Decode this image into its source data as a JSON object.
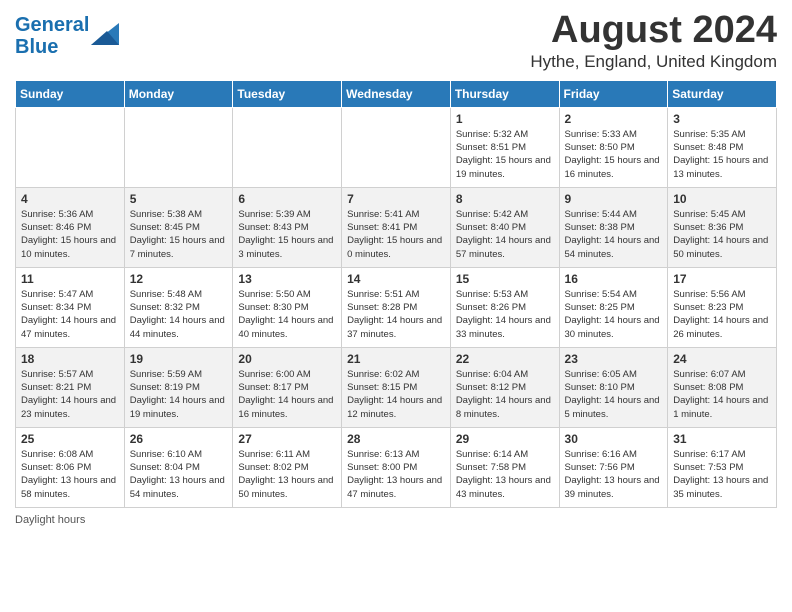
{
  "logo": {
    "line1": "General",
    "line2": "Blue"
  },
  "title": "August 2024",
  "subtitle": "Hythe, England, United Kingdom",
  "days_of_week": [
    "Sunday",
    "Monday",
    "Tuesday",
    "Wednesday",
    "Thursday",
    "Friday",
    "Saturday"
  ],
  "weeks": [
    [
      {
        "day": "",
        "info": ""
      },
      {
        "day": "",
        "info": ""
      },
      {
        "day": "",
        "info": ""
      },
      {
        "day": "",
        "info": ""
      },
      {
        "day": "1",
        "info": "Sunrise: 5:32 AM\nSunset: 8:51 PM\nDaylight: 15 hours\nand 19 minutes."
      },
      {
        "day": "2",
        "info": "Sunrise: 5:33 AM\nSunset: 8:50 PM\nDaylight: 15 hours\nand 16 minutes."
      },
      {
        "day": "3",
        "info": "Sunrise: 5:35 AM\nSunset: 8:48 PM\nDaylight: 15 hours\nand 13 minutes."
      }
    ],
    [
      {
        "day": "4",
        "info": "Sunrise: 5:36 AM\nSunset: 8:46 PM\nDaylight: 15 hours\nand 10 minutes."
      },
      {
        "day": "5",
        "info": "Sunrise: 5:38 AM\nSunset: 8:45 PM\nDaylight: 15 hours\nand 7 minutes."
      },
      {
        "day": "6",
        "info": "Sunrise: 5:39 AM\nSunset: 8:43 PM\nDaylight: 15 hours\nand 3 minutes."
      },
      {
        "day": "7",
        "info": "Sunrise: 5:41 AM\nSunset: 8:41 PM\nDaylight: 15 hours\nand 0 minutes."
      },
      {
        "day": "8",
        "info": "Sunrise: 5:42 AM\nSunset: 8:40 PM\nDaylight: 14 hours\nand 57 minutes."
      },
      {
        "day": "9",
        "info": "Sunrise: 5:44 AM\nSunset: 8:38 PM\nDaylight: 14 hours\nand 54 minutes."
      },
      {
        "day": "10",
        "info": "Sunrise: 5:45 AM\nSunset: 8:36 PM\nDaylight: 14 hours\nand 50 minutes."
      }
    ],
    [
      {
        "day": "11",
        "info": "Sunrise: 5:47 AM\nSunset: 8:34 PM\nDaylight: 14 hours\nand 47 minutes."
      },
      {
        "day": "12",
        "info": "Sunrise: 5:48 AM\nSunset: 8:32 PM\nDaylight: 14 hours\nand 44 minutes."
      },
      {
        "day": "13",
        "info": "Sunrise: 5:50 AM\nSunset: 8:30 PM\nDaylight: 14 hours\nand 40 minutes."
      },
      {
        "day": "14",
        "info": "Sunrise: 5:51 AM\nSunset: 8:28 PM\nDaylight: 14 hours\nand 37 minutes."
      },
      {
        "day": "15",
        "info": "Sunrise: 5:53 AM\nSunset: 8:26 PM\nDaylight: 14 hours\nand 33 minutes."
      },
      {
        "day": "16",
        "info": "Sunrise: 5:54 AM\nSunset: 8:25 PM\nDaylight: 14 hours\nand 30 minutes."
      },
      {
        "day": "17",
        "info": "Sunrise: 5:56 AM\nSunset: 8:23 PM\nDaylight: 14 hours\nand 26 minutes."
      }
    ],
    [
      {
        "day": "18",
        "info": "Sunrise: 5:57 AM\nSunset: 8:21 PM\nDaylight: 14 hours\nand 23 minutes."
      },
      {
        "day": "19",
        "info": "Sunrise: 5:59 AM\nSunset: 8:19 PM\nDaylight: 14 hours\nand 19 minutes."
      },
      {
        "day": "20",
        "info": "Sunrise: 6:00 AM\nSunset: 8:17 PM\nDaylight: 14 hours\nand 16 minutes."
      },
      {
        "day": "21",
        "info": "Sunrise: 6:02 AM\nSunset: 8:15 PM\nDaylight: 14 hours\nand 12 minutes."
      },
      {
        "day": "22",
        "info": "Sunrise: 6:04 AM\nSunset: 8:12 PM\nDaylight: 14 hours\nand 8 minutes."
      },
      {
        "day": "23",
        "info": "Sunrise: 6:05 AM\nSunset: 8:10 PM\nDaylight: 14 hours\nand 5 minutes."
      },
      {
        "day": "24",
        "info": "Sunrise: 6:07 AM\nSunset: 8:08 PM\nDaylight: 14 hours\nand 1 minute."
      }
    ],
    [
      {
        "day": "25",
        "info": "Sunrise: 6:08 AM\nSunset: 8:06 PM\nDaylight: 13 hours\nand 58 minutes."
      },
      {
        "day": "26",
        "info": "Sunrise: 6:10 AM\nSunset: 8:04 PM\nDaylight: 13 hours\nand 54 minutes."
      },
      {
        "day": "27",
        "info": "Sunrise: 6:11 AM\nSunset: 8:02 PM\nDaylight: 13 hours\nand 50 minutes."
      },
      {
        "day": "28",
        "info": "Sunrise: 6:13 AM\nSunset: 8:00 PM\nDaylight: 13 hours\nand 47 minutes."
      },
      {
        "day": "29",
        "info": "Sunrise: 6:14 AM\nSunset: 7:58 PM\nDaylight: 13 hours\nand 43 minutes."
      },
      {
        "day": "30",
        "info": "Sunrise: 6:16 AM\nSunset: 7:56 PM\nDaylight: 13 hours\nand 39 minutes."
      },
      {
        "day": "31",
        "info": "Sunrise: 6:17 AM\nSunset: 7:53 PM\nDaylight: 13 hours\nand 35 minutes."
      }
    ]
  ],
  "footer": "Daylight hours"
}
